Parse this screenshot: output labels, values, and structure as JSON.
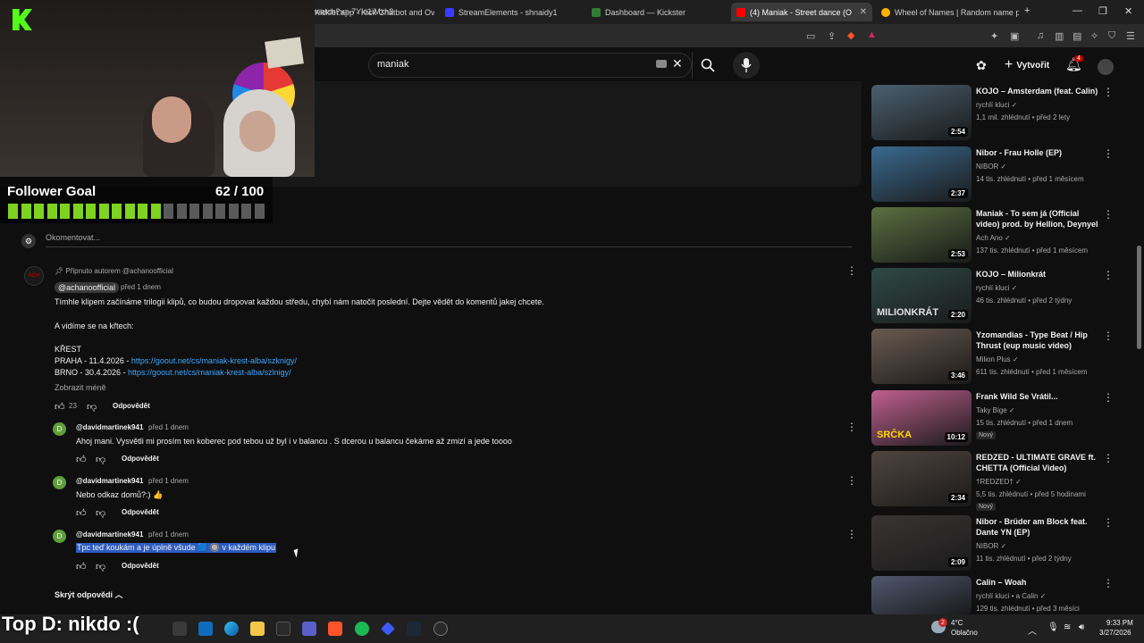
{
  "browser": {
    "tabs": [
      {
        "label": "Kicklet.app - Kick Chatbot and Overl",
        "color": "#53fc18"
      },
      {
        "label": "StreamElements - shnaidy1",
        "color": "#a0a0ff"
      },
      {
        "label": "Dashboard — Kickster",
        "color": "#4caf50"
      },
      {
        "label": "(4) Maniak - Street dance (Offici",
        "color": "#ff0000"
      },
      {
        "label": "Wheel of Names | Random name pi",
        "color": "#ffb300"
      }
    ],
    "url": "watch?v=-7Yle1iMxh8"
  },
  "youtube": {
    "search_value": "maniak",
    "create_label": "Vytvořit",
    "notif_count": "4"
  },
  "overlay": {
    "goal_title": "Follower Goal",
    "goal_count": "62 / 100",
    "goal_value": 0.62,
    "top_donor": "Top D: nikdo :("
  },
  "comments": {
    "add_placeholder": "Okomentovat...",
    "pinned_label": "Připnuto autorem @achanoofficial",
    "main": {
      "author": "@achanoofficial",
      "time": "před 1 dnem",
      "line1": "Tímhle klipem začínáme trilogii klipů, co budou dropovat každou středu, chybí nám natočit poslední. Dejte vědět do komentů jakej chcete.",
      "line2": "A vidíme se na křtech:",
      "line3": "KŘEST",
      "praha_prefix": "PRAHA - 11.4.2026 - ",
      "praha_link": "https://goout.net/cs/maniak-krest-alba/szknigy/",
      "brno_prefix": "BRNO -  30.4.2026 - ",
      "brno_link": "https://goout.net/cs/maniak-krest-alba/szlnigy/",
      "show_less": "Zobrazit méně",
      "likes": "23",
      "reply": "Odpovědět"
    },
    "replies": [
      {
        "author": "@davidmartinek941",
        "time": "před 1 dnem",
        "text": "Ahoj mani. Vysvětli mi prosím ten koberec pod tebou už byl i v balancu . S dcerou u balancu čekáme až zmizí a jede toooo",
        "reply": "Odpovědět"
      },
      {
        "author": "@davidmartinek941",
        "time": "před 1 dnem",
        "text": "Nebo odkaz domů?:) 👍",
        "reply": "Odpovědět"
      },
      {
        "author": "@davidmartinek941",
        "time": "před 1 dnem",
        "text": "Tpc teď koukám a je úplně všude 🟦 🔘 v každém klipu",
        "reply": "Odpovědět"
      }
    ],
    "hide_replies": "Skrýt odpovědi"
  },
  "suggestions": [
    {
      "title": "KOJO – Amsterdam (feat. Calin)",
      "channel": "rychlí kluci",
      "meta": "1,1 mil. zhlédnutí • před 2 lety",
      "duration": "2:54",
      "thumb": "#4a6070"
    },
    {
      "title": "Nibor - Frau Holle (EP)",
      "channel": "NIBOR",
      "meta": "14 tis. zhlédnutí • před 1 měsícem",
      "duration": "2:37",
      "thumb": "#3a6a90"
    },
    {
      "title": "Maniak - To sem já (Official video) prod. by Hellion, Deynyel",
      "channel": "Ach Ano",
      "meta": "137 tis. zhlédnutí • před 1 měsícem",
      "duration": "2:53",
      "thumb": "#5a7040"
    },
    {
      "title": "KOJO – Milionkrát",
      "channel": "rychlí kluci",
      "meta": "46 tis. zhlédnutí • před 2 týdny",
      "duration": "2:20",
      "thumb": "#2f4a45",
      "overlay_text": "MILIONKRÁT"
    },
    {
      "title": "Yzomandias - Type Beat / Hip Thrust (eup music video)",
      "channel": "Milion Plus",
      "meta": "611 tis. zhlédnutí • před 1 měsícem",
      "duration": "3:46",
      "thumb": "#6a5a50"
    },
    {
      "title": "Frank Wild Se Vrátil...",
      "channel": "Taky Bige",
      "meta": "15 tis. zhlédnutí • před 1 dnem",
      "duration": "10:12",
      "thumb": "#c06090",
      "badge": "Nový",
      "overlay_text": "SRČKA"
    },
    {
      "title": "REDZED - ULTIMATE GRAVE ft. CHETTA (Official Video)",
      "channel": "†REDZED†",
      "meta": "5,5 tis. zhlédnutí • před 5 hodinami",
      "duration": "2:34",
      "thumb": "#504540",
      "badge": "Nový"
    },
    {
      "title": "Nibor - Brüder am Block feat. Dante YN (EP)",
      "channel": "NIBOR",
      "meta": "11 tis. zhlédnutí • před 2 týdny",
      "duration": "2:09",
      "thumb": "#3a3535"
    },
    {
      "title": "Calin – Woah",
      "channel": "rychlí kluci • a Calin",
      "meta": "129 tis. zhlédnutí • před 3 měsíci",
      "duration": "",
      "thumb": "#505870"
    }
  ],
  "taskbar": {
    "weather_temp": "4°C",
    "weather_desc": "Oblačno",
    "weather_badge": "2",
    "time": "9:33 PM",
    "date": "3/27/2026"
  }
}
